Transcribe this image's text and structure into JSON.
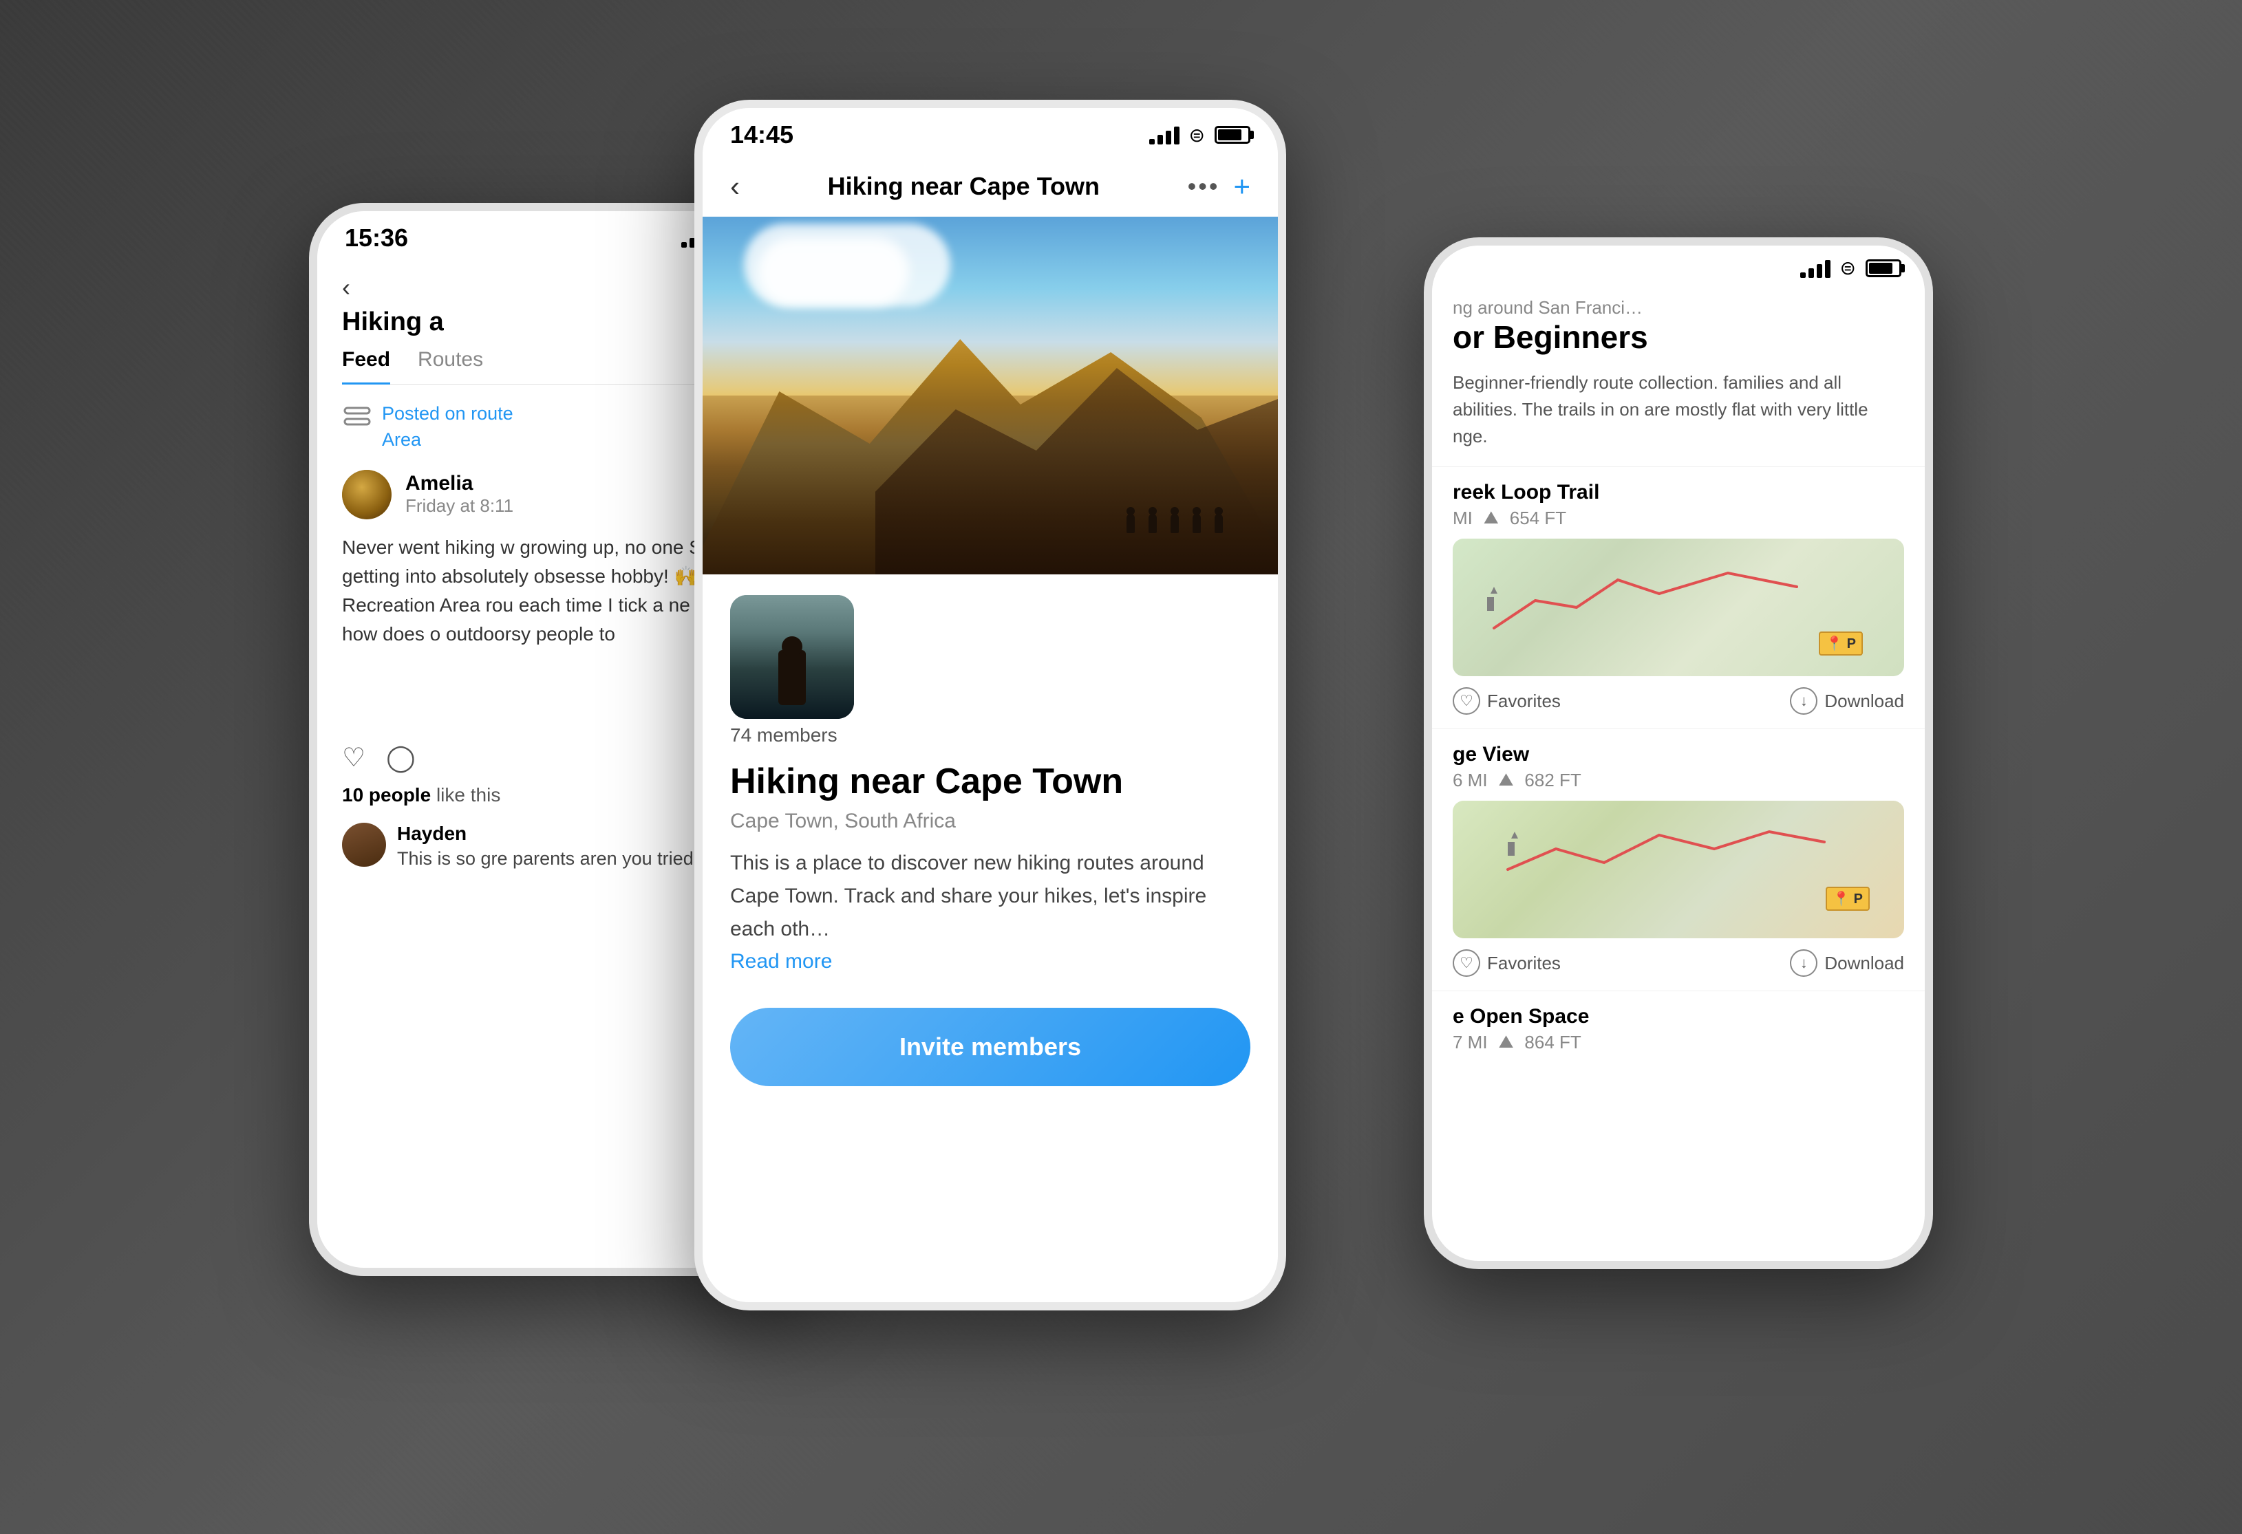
{
  "background": {
    "color": "#2a2a2a"
  },
  "left_phone": {
    "status_time": "15:36",
    "header_title": "Hiking a",
    "back_label": "‹",
    "tabs": [
      "Feed",
      "Routes"
    ],
    "active_tab": "Feed",
    "post": {
      "route_tag": "Posted on route",
      "route_area": "Area",
      "user_name": "Amelia",
      "user_time": "Friday at 8:11",
      "post_text": "Never went hiking w growing up, no one Started getting into absolutely obsesse hobby! 🙌 Complet Recreation Area rou each time I tick a ne Anyway, how does o outdoorsy people to",
      "likes_text": "10 people",
      "likes_suffix": "like this",
      "comment_user": "Hayden",
      "comment_text": "This is so gre parents aren you tried sug"
    }
  },
  "center_phone": {
    "status_time": "14:45",
    "header_title": "Hiking near Cape Town",
    "dots": "•••",
    "plus": "+",
    "hero_alt": "Mountain landscape at sunset near Cape Town",
    "group_members": "74 members",
    "group_title": "Hiking near Cape Town",
    "group_location": "Cape Town, South Africa",
    "group_description": "This is a place to discover new hiking routes around Cape Town. Track and share your hikes, let's inspire each oth…",
    "read_more": "Read more",
    "invite_button": "Invite members"
  },
  "right_phone": {
    "title_small": "ng around San Franci…",
    "title_section": "or Beginners",
    "description": "Beginner-friendly route collection. families and all abilities. The trails in on are mostly flat with very little nge.",
    "routes": [
      {
        "name": "reek Loop Trail",
        "distance": "MI",
        "elevation": "654 FT",
        "map_alt": "Trail map",
        "actions": [
          "Favorites",
          "Download"
        ]
      },
      {
        "name": "ge View",
        "distance": "6 MI",
        "elevation": "682 FT",
        "map_alt": "Trail map",
        "actions": [
          "Favorites",
          "Download"
        ]
      },
      {
        "name": "e Open Space",
        "distance": "7 MI",
        "elevation": "864 FT",
        "map_alt": "Trail map partial"
      }
    ],
    "favorites_label": "Favorites",
    "download_label": "Download"
  }
}
